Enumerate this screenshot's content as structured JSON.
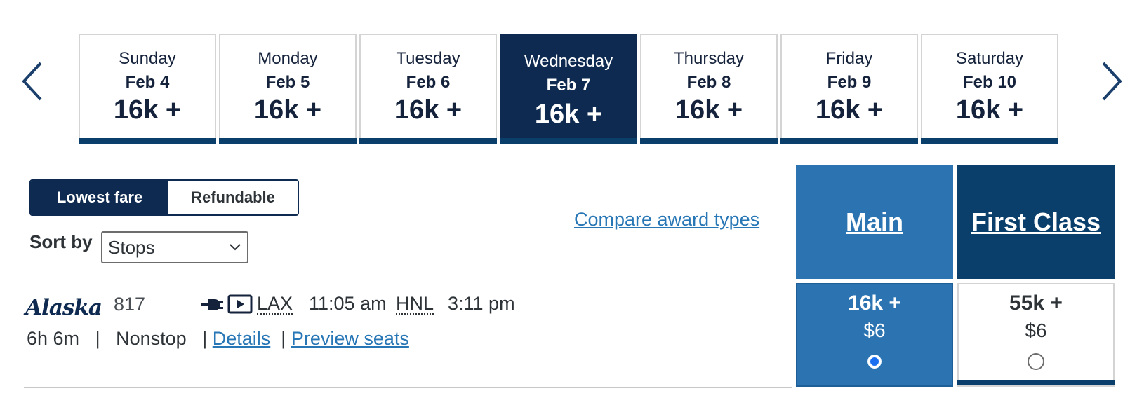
{
  "nav": {
    "prev_icon": "chevron-left-icon",
    "next_icon": "chevron-right-icon"
  },
  "dates": [
    {
      "day": "Sunday",
      "date": "Feb 4",
      "price": "16k +",
      "selected": false
    },
    {
      "day": "Monday",
      "date": "Feb 5",
      "price": "16k +",
      "selected": false
    },
    {
      "day": "Tuesday",
      "date": "Feb 6",
      "price": "16k +",
      "selected": false
    },
    {
      "day": "Wednesday",
      "date": "Feb 7",
      "price": "16k +",
      "selected": true
    },
    {
      "day": "Thursday",
      "date": "Feb 8",
      "price": "16k +",
      "selected": false
    },
    {
      "day": "Friday",
      "date": "Feb 9",
      "price": "16k +",
      "selected": false
    },
    {
      "day": "Saturday",
      "date": "Feb 10",
      "price": "16k +",
      "selected": false
    }
  ],
  "fare_toggle": {
    "active": "Lowest fare",
    "inactive": "Refundable"
  },
  "sort": {
    "label": "Sort by",
    "value": "Stops"
  },
  "compare_link": "Compare award types",
  "cabins": {
    "main": {
      "label": "Main"
    },
    "first": {
      "label": "First Class"
    }
  },
  "flight": {
    "airline": "Alaska",
    "number": "817",
    "amenities": [
      "power-outlet-icon",
      "video-icon"
    ],
    "origin": "LAX",
    "depart": "11:05 am",
    "destination": "HNL",
    "arrive": "3:11 pm",
    "duration": "6h 6m",
    "stops": "Nonstop",
    "details_link": "Details",
    "seats_link": "Preview seats",
    "fares": {
      "main": {
        "miles": "16k +",
        "tax": "$6",
        "selected": true
      },
      "first": {
        "miles": "55k +",
        "tax": "$6",
        "selected": false
      }
    }
  },
  "colors": {
    "navy": "#0e2a50",
    "blue": "#2b74b1",
    "dark_blue": "#0a3e6b",
    "link": "#2776b5"
  }
}
